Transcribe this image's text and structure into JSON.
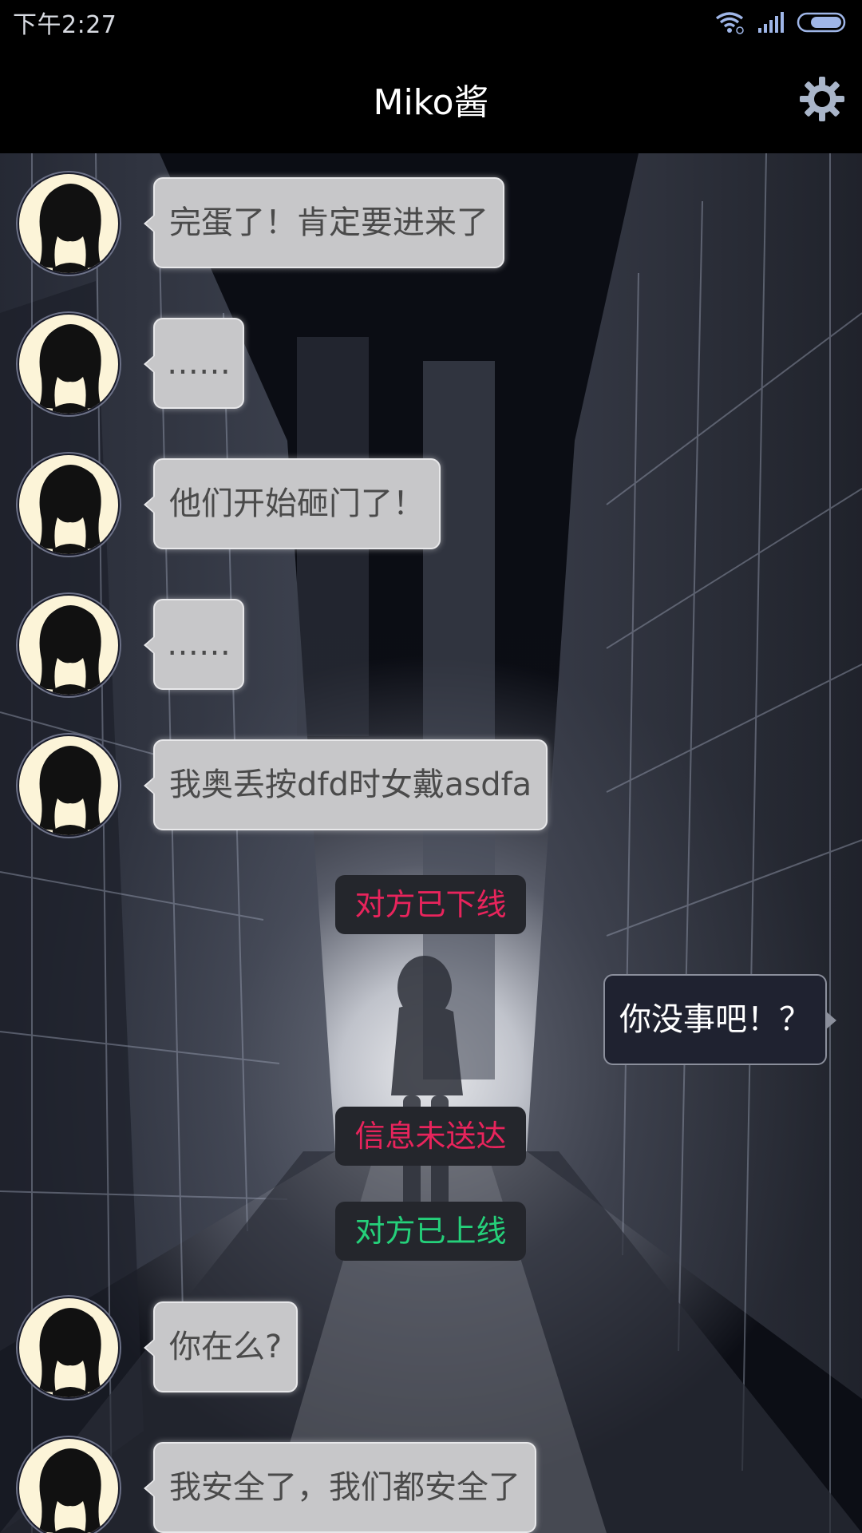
{
  "status_bar": {
    "time": "下午2:27"
  },
  "header": {
    "title": "Miko酱"
  },
  "colors": {
    "offline_text": "#e8245c",
    "undelivered_text": "#e8245c",
    "online_text": "#25d07a"
  },
  "messages": [
    {
      "type": "incoming",
      "text": "完蛋了！肯定要进来了"
    },
    {
      "type": "incoming",
      "text": "……"
    },
    {
      "type": "incoming",
      "text": "他们开始砸门了！"
    },
    {
      "type": "incoming",
      "text": "……"
    },
    {
      "type": "incoming",
      "text": "我奥丢按dfd时女戴asdfa"
    },
    {
      "type": "system",
      "text": "对方已下线"
    },
    {
      "type": "outgoing",
      "text": "你没事吧！？"
    },
    {
      "type": "system",
      "text": "信息未送达"
    },
    {
      "type": "system",
      "text": "对方已上线"
    },
    {
      "type": "incoming",
      "text": "你在么?"
    },
    {
      "type": "incoming",
      "text": "我安全了，我们都安全了"
    }
  ]
}
